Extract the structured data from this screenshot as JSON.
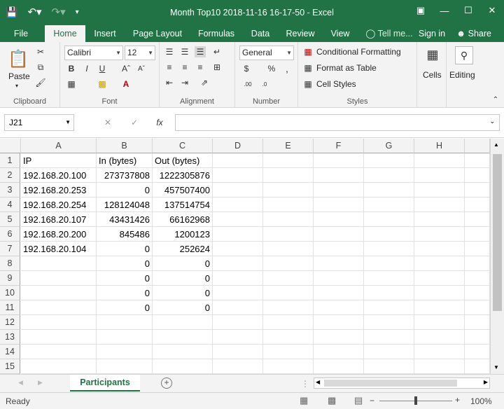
{
  "window": {
    "title": "Month Top10 2018-11-16 16-17-50 - Excel"
  },
  "ribbon_tabs": [
    "File",
    "Home",
    "Insert",
    "Page Layout",
    "Formulas",
    "Data",
    "Review",
    "View"
  ],
  "tell_me": "Tell me...",
  "sign_in": "Sign in",
  "share": "Share",
  "ribbon": {
    "paste": "Paste",
    "font_name": "Calibri",
    "font_size": "12",
    "number_format": "General",
    "conditional_formatting": "Conditional Formatting",
    "format_as_table": "Format as Table",
    "cell_styles": "Cell Styles",
    "cells": "Cells",
    "editing": "Editing",
    "groups": {
      "clipboard": "Clipboard",
      "font": "Font",
      "alignment": "Alignment",
      "number": "Number",
      "styles": "Styles"
    }
  },
  "formula_bar": {
    "name_box": "J21",
    "fx": "fx",
    "content": ""
  },
  "columns": [
    "A",
    "B",
    "C",
    "D",
    "E",
    "F",
    "G",
    "H"
  ],
  "rows": [
    {
      "n": "1",
      "a": "IP",
      "b": "In (bytes)",
      "c": "Out (bytes)"
    },
    {
      "n": "2",
      "a": "192.168.20.100",
      "b": "273737808",
      "c": "1222305876"
    },
    {
      "n": "3",
      "a": "192.168.20.253",
      "b": "0",
      "c": "457507400"
    },
    {
      "n": "4",
      "a": "192.168.20.254",
      "b": "128124048",
      "c": "137514754"
    },
    {
      "n": "5",
      "a": "192.168.20.107",
      "b": "43431426",
      "c": "66162968"
    },
    {
      "n": "6",
      "a": "192.168.20.200",
      "b": "845486",
      "c": "1200123"
    },
    {
      "n": "7",
      "a": "192.168.20.104",
      "b": "0",
      "c": "252624"
    },
    {
      "n": "8",
      "a": "",
      "b": "0",
      "c": "0"
    },
    {
      "n": "9",
      "a": "",
      "b": "0",
      "c": "0"
    },
    {
      "n": "10",
      "a": "",
      "b": "0",
      "c": "0"
    },
    {
      "n": "11",
      "a": "",
      "b": "0",
      "c": "0"
    },
    {
      "n": "12",
      "a": "",
      "b": "",
      "c": ""
    },
    {
      "n": "13",
      "a": "",
      "b": "",
      "c": ""
    },
    {
      "n": "14",
      "a": "",
      "b": "",
      "c": ""
    },
    {
      "n": "15",
      "a": "",
      "b": "",
      "c": ""
    }
  ],
  "sheet_tab": "Participants",
  "status": {
    "ready": "Ready",
    "zoom": "100%"
  }
}
